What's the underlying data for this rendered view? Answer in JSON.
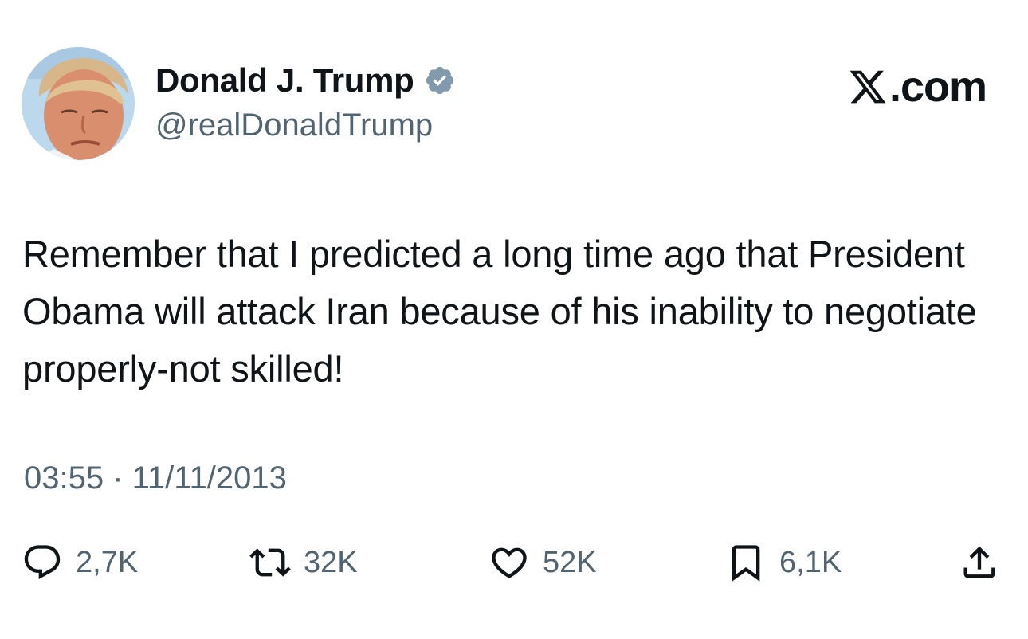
{
  "author": {
    "display_name": "Donald J. Trump",
    "handle": "@realDonaldTrump",
    "verified": true,
    "verified_color": "#829aab"
  },
  "brand": {
    "suffix": ".com"
  },
  "tweet": {
    "text": "Remember that I predicted a long time ago that President Obama will attack Iran because of his inability to negotiate properly-not skilled!",
    "timestamp": "03:55 · 11/11/2013"
  },
  "actions": {
    "replies": "2,7K",
    "reposts": "32K",
    "likes": "52K",
    "bookmarks": "6,1K"
  },
  "icons": [
    "avatar",
    "verified-badge-icon",
    "x-logo-icon",
    "reply-icon",
    "repost-icon",
    "like-icon",
    "bookmark-icon",
    "share-icon"
  ],
  "colors": {
    "text": "#0f1419",
    "secondary": "#536471",
    "background": "#ffffff"
  }
}
